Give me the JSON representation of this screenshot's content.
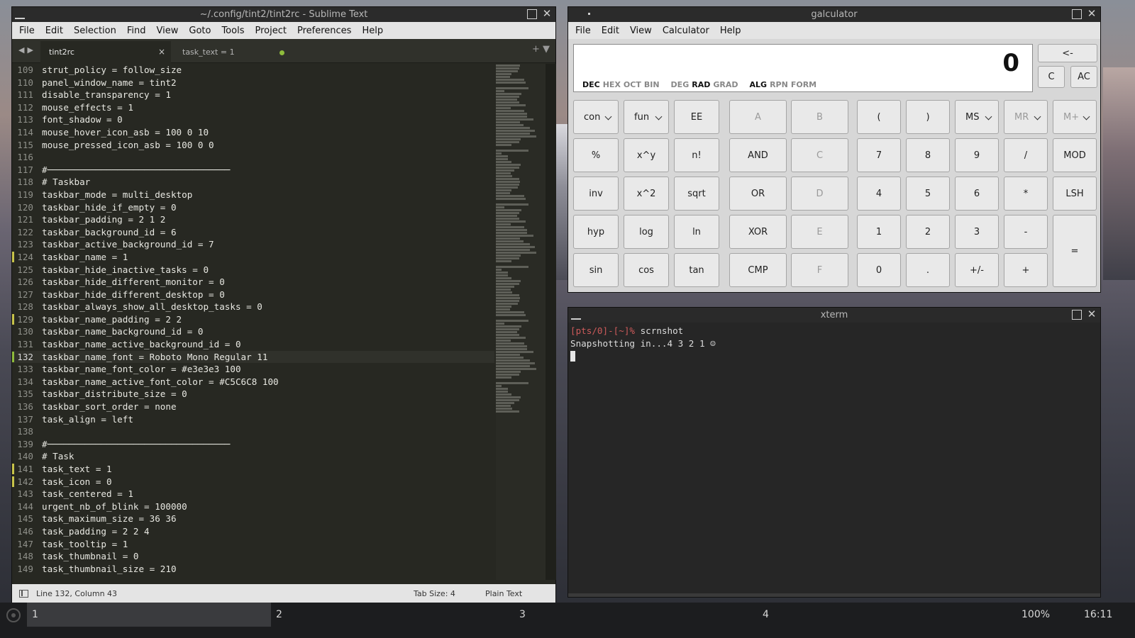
{
  "sublime": {
    "title": "~/.config/tint2/tint2rc - Sublime Text",
    "menu": [
      "File",
      "Edit",
      "Selection",
      "Find",
      "View",
      "Goto",
      "Tools",
      "Project",
      "Preferences",
      "Help"
    ],
    "tabs": [
      {
        "label": "tint2rc"
      },
      {
        "label": "task_text = 1"
      }
    ],
    "tab_close": "×",
    "nav_arrows": "◀▶",
    "tab_right": "+ ▼",
    "lines": [
      {
        "n": "109",
        "t": "strut_policy = follow_size"
      },
      {
        "n": "110",
        "t": "panel_window_name = tint2"
      },
      {
        "n": "111",
        "t": "disable_transparency = 1"
      },
      {
        "n": "112",
        "t": "mouse_effects = 1"
      },
      {
        "n": "113",
        "t": "font_shadow = 0"
      },
      {
        "n": "114",
        "t": "mouse_hover_icon_asb = 100 0 10"
      },
      {
        "n": "115",
        "t": "mouse_pressed_icon_asb = 100 0 0"
      },
      {
        "n": "116",
        "t": ""
      },
      {
        "n": "117",
        "t": "#──────────────────────────────────"
      },
      {
        "n": "118",
        "t": "# Taskbar"
      },
      {
        "n": "119",
        "t": "taskbar_mode = multi_desktop"
      },
      {
        "n": "120",
        "t": "taskbar_hide_if_empty = 0"
      },
      {
        "n": "121",
        "t": "taskbar_padding = 2 1 2"
      },
      {
        "n": "122",
        "t": "taskbar_background_id = 6"
      },
      {
        "n": "123",
        "t": "taskbar_active_background_id = 7"
      },
      {
        "n": "124",
        "t": "taskbar_name = 1",
        "mark": "yellow"
      },
      {
        "n": "125",
        "t": "taskbar_hide_inactive_tasks = 0"
      },
      {
        "n": "126",
        "t": "taskbar_hide_different_monitor = 0"
      },
      {
        "n": "127",
        "t": "taskbar_hide_different_desktop = 0"
      },
      {
        "n": "128",
        "t": "taskbar_always_show_all_desktop_tasks = 0"
      },
      {
        "n": "129",
        "t": "taskbar_name_padding = 2 2",
        "mark": "yellow"
      },
      {
        "n": "130",
        "t": "taskbar_name_background_id = 0"
      },
      {
        "n": "131",
        "t": "taskbar_name_active_background_id = 0"
      },
      {
        "n": "132",
        "t": "taskbar_name_font = Roboto Mono Regular 11",
        "mark": "green",
        "current": true
      },
      {
        "n": "133",
        "t": "taskbar_name_font_color = #e3e3e3 100"
      },
      {
        "n": "134",
        "t": "taskbar_name_active_font_color = #C5C6C8 100"
      },
      {
        "n": "135",
        "t": "taskbar_distribute_size = 0"
      },
      {
        "n": "136",
        "t": "taskbar_sort_order = none"
      },
      {
        "n": "137",
        "t": "task_align = left"
      },
      {
        "n": "138",
        "t": ""
      },
      {
        "n": "139",
        "t": "#──────────────────────────────────"
      },
      {
        "n": "140",
        "t": "# Task"
      },
      {
        "n": "141",
        "t": "task_text = 1",
        "mark": "yellow"
      },
      {
        "n": "142",
        "t": "task_icon = 0",
        "mark": "yellow"
      },
      {
        "n": "143",
        "t": "task_centered = 1"
      },
      {
        "n": "144",
        "t": "urgent_nb_of_blink = 100000"
      },
      {
        "n": "145",
        "t": "task_maximum_size = 36 36"
      },
      {
        "n": "146",
        "t": "task_padding = 2 2 4"
      },
      {
        "n": "147",
        "t": "task_tooltip = 1"
      },
      {
        "n": "148",
        "t": "task_thumbnail = 0"
      },
      {
        "n": "149",
        "t": "task_thumbnail_size = 210"
      }
    ],
    "status": {
      "position": "Line 132, Column 43",
      "tab_size": "Tab Size: 4",
      "syntax": "Plain Text"
    }
  },
  "galculator": {
    "title": "galculator",
    "menu": [
      "File",
      "Edit",
      "View",
      "Calculator",
      "Help"
    ],
    "display_value": "0",
    "modes": [
      {
        "label": "DEC",
        "on": true
      },
      {
        "label": "HEX"
      },
      {
        "label": "OCT"
      },
      {
        "label": "BIN"
      },
      {
        "label": "DEG",
        "gap": true
      },
      {
        "label": "RAD",
        "on": true
      },
      {
        "label": "GRAD"
      },
      {
        "label": "ALG",
        "gap": true,
        "on": true
      },
      {
        "label": "RPN"
      },
      {
        "label": "FORM"
      }
    ],
    "top_buttons": [
      "<-",
      "C",
      "AC"
    ],
    "rows": [
      [
        "con",
        "fun",
        "EE",
        "A",
        "B",
        "(",
        ")",
        "MS",
        "MR",
        "M+"
      ],
      [
        "%",
        "x^y",
        "n!",
        "AND",
        "C",
        "7",
        "8",
        "9",
        "/",
        "MOD"
      ],
      [
        "inv",
        "x^2",
        "sqrt",
        "OR",
        "D",
        "4",
        "5",
        "6",
        "*",
        "LSH"
      ],
      [
        "hyp",
        "log",
        "ln",
        "XOR",
        "E",
        "1",
        "2",
        "3",
        "-",
        "="
      ],
      [
        "sin",
        "cos",
        "tan",
        "CMP",
        "F",
        "0",
        ".",
        "+/-",
        "+"
      ]
    ]
  },
  "xterm": {
    "title": "xterm",
    "prompt": "[pts/0]-[~]%",
    "command": " scrnshot",
    "output": "Snapshotting in...4 3 2 1 ☺"
  },
  "panel": {
    "workspaces": [
      "1",
      "2",
      "3",
      "4"
    ],
    "volume": "100%",
    "clock": "16:11"
  },
  "icons": {
    "close": "close-icon",
    "maximize": "maximize-icon",
    "window_menu": "window-menu-icon",
    "panel_logo": "panel-logo-icon"
  }
}
